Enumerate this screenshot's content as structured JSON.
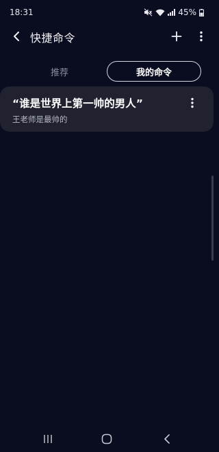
{
  "status_bar": {
    "time": "18:31",
    "battery_percent": "45%",
    "icons": [
      "mute-icon",
      "wifi-icon",
      "signal-icon",
      "battery-icon"
    ]
  },
  "app_bar": {
    "title": "快捷命令",
    "icons": [
      "back-icon",
      "plus-icon",
      "more-vertical-icon"
    ]
  },
  "tabs": [
    {
      "label": "推荐",
      "selected": false
    },
    {
      "label": "我的命令",
      "selected": true
    }
  ],
  "commands": [
    {
      "name": "“谁是世界上第一帅的男人”",
      "action": "王老师是最帅的"
    }
  ],
  "nav_bar": {
    "icons": [
      "recents-icon",
      "home-icon",
      "nav-back-icon"
    ]
  },
  "colors": {
    "background": "#0a0c1f",
    "card": "#20232f",
    "tab_inactive_text": "#8a8c9a",
    "tab_active_border": "#d8d9e0"
  }
}
